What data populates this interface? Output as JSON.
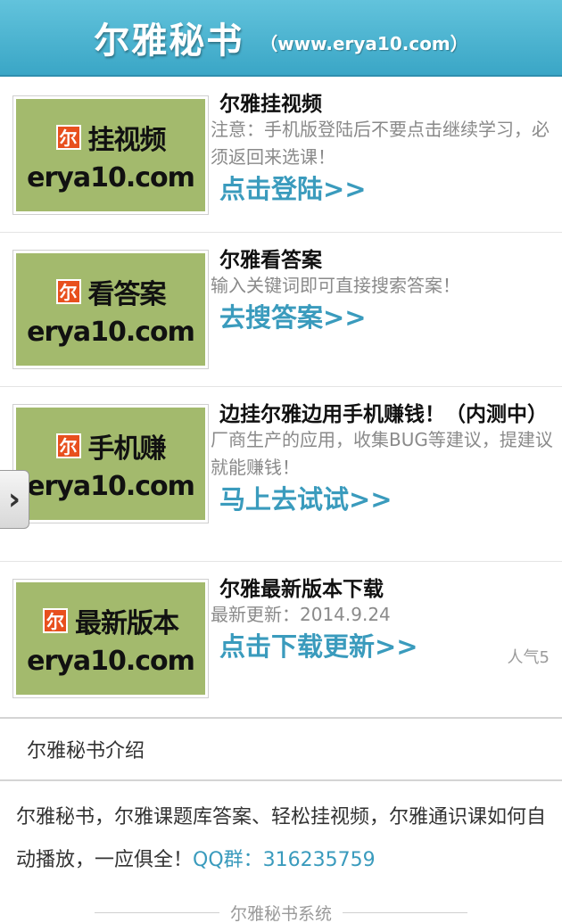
{
  "header": {
    "title": "尔雅秘书",
    "url": "（www.erya10.com）"
  },
  "items": [
    {
      "thumb_name": "挂视频",
      "thumb_domain": "erya10.com",
      "logo_char": "尔",
      "name": "尔雅挂视频",
      "desc": "注意：手机版登陆后不要点击继续学习，必须返回来选课！",
      "action": "点击登陆>>"
    },
    {
      "thumb_name": "看答案",
      "thumb_domain": "erya10.com",
      "logo_char": "尔",
      "name": "尔雅看答案",
      "desc": "输入关键词即可直接搜索答案！",
      "action": "去搜答案>>"
    },
    {
      "thumb_name": "手机赚",
      "thumb_domain": "erya10.com",
      "logo_char": "尔",
      "name": "边挂尔雅边用手机赚钱！（内测中）",
      "desc": "厂商生产的应用，收集BUG等建议，提建议就能赚钱！",
      "action": "马上去试试>>"
    },
    {
      "thumb_name": "最新版本",
      "thumb_domain": "erya10.com",
      "logo_char": "尔",
      "name": "尔雅最新版本下载",
      "desc": "最新更新：2014.9.24",
      "action": "点击下载更新>>",
      "popularity": "人气5"
    }
  ],
  "side_tab": {
    "glyph": "›"
  },
  "section": {
    "title": "尔雅秘书介绍"
  },
  "intro": {
    "text": "尔雅秘书，尔雅课题库答案、轻松挂视频，尔雅通识课如何自动播放，一应俱全！",
    "qq": "QQ群：316235759"
  },
  "footer": {
    "text": "尔雅秘书系统"
  }
}
